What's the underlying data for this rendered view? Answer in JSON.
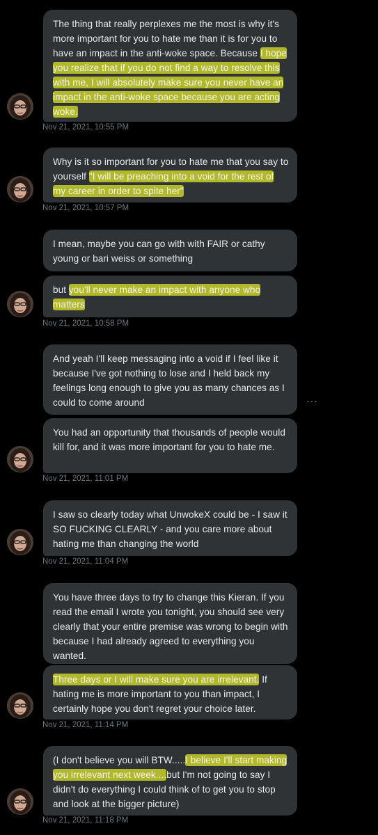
{
  "messages": [
    {
      "segments": [
        {
          "text": "The thing that really perplexes me the most is why it's more important for you to hate me than it is for you to have an impact in the anti-woke space. Because ",
          "hl": false
        },
        {
          "text": "I hope you realize that if you do not find a way to resolve this with me, I will absolutely make sure you never have an impact in the anti-woke space because you are acting woke.",
          "hl": true
        }
      ]
    },
    {
      "segments": [
        {
          "text": "Why is it so important for you to hate me that you say to yourself ",
          "hl": false
        },
        {
          "text": "\"I will be preaching into a void for the rest of my career in order to spite her\"",
          "hl": true
        }
      ]
    },
    {
      "segments": [
        {
          "text": "I mean, maybe you can go with with FAIR or cathy young or bari weiss or something",
          "hl": false
        }
      ]
    },
    {
      "segments": [
        {
          "text": "but ",
          "hl": false
        },
        {
          "text": "you'll never make an impact with anyone who matters",
          "hl": true
        }
      ]
    },
    {
      "segments": [
        {
          "text": "And yeah I'll keep messaging into a void if I feel like it because I've got nothing to lose and I held back my feelings long enough to give you as many chances as I could to come around",
          "hl": false
        }
      ]
    },
    {
      "segments": [
        {
          "text": "You had an opportunity that thousands of people would kill for, and it was more important for you to hate me.",
          "hl": false
        }
      ]
    },
    {
      "segments": [
        {
          "text": "I saw so clearly today what UnwokeX could be - I saw it SO FUCKING CLEARLY - and you care more about hating me than changing the world",
          "hl": false
        }
      ]
    },
    {
      "segments": [
        {
          "text": "You have three days to try to change this Kieran. If you read the email I wrote you tonight, you should see very clearly that your entire premise was wrong to begin with because I had already agreed to everything you wanted.",
          "hl": false
        }
      ]
    },
    {
      "segments": [
        {
          "text": "Three days or I will make sure you are irrelevant.",
          "hl": true
        },
        {
          "text": " If hating me is more important to you than impact, I certainly hope you don't regret your choice later.",
          "hl": false
        }
      ]
    },
    {
      "segments": [
        {
          "text": "(I don't believe you will BTW.....",
          "hl": false
        },
        {
          "text": "I believe I'll start making you irrelevant next week....",
          "hl": true
        },
        {
          "text": "but I'm not going to say I didn't do everything I could think of to get you to stop and look at the bigger picture)",
          "hl": false
        }
      ]
    }
  ],
  "timestamps": [
    "Nov 21, 2021, 10:55 PM",
    "Nov 21, 2021, 10:57 PM",
    "Nov 21, 2021, 10:58 PM",
    "Nov 21, 2021, 11:01 PM",
    "Nov 21, 2021, 11:04 PM",
    "Nov 21, 2021, 11:14 PM",
    "Nov 21, 2021, 11:18 PM"
  ],
  "more_icon": "···",
  "colors": {
    "background": "#000000",
    "bubble": "#2f3336",
    "highlight": "#d6de28",
    "timestamp": "#6e767d",
    "text": "#e7e9ea"
  }
}
